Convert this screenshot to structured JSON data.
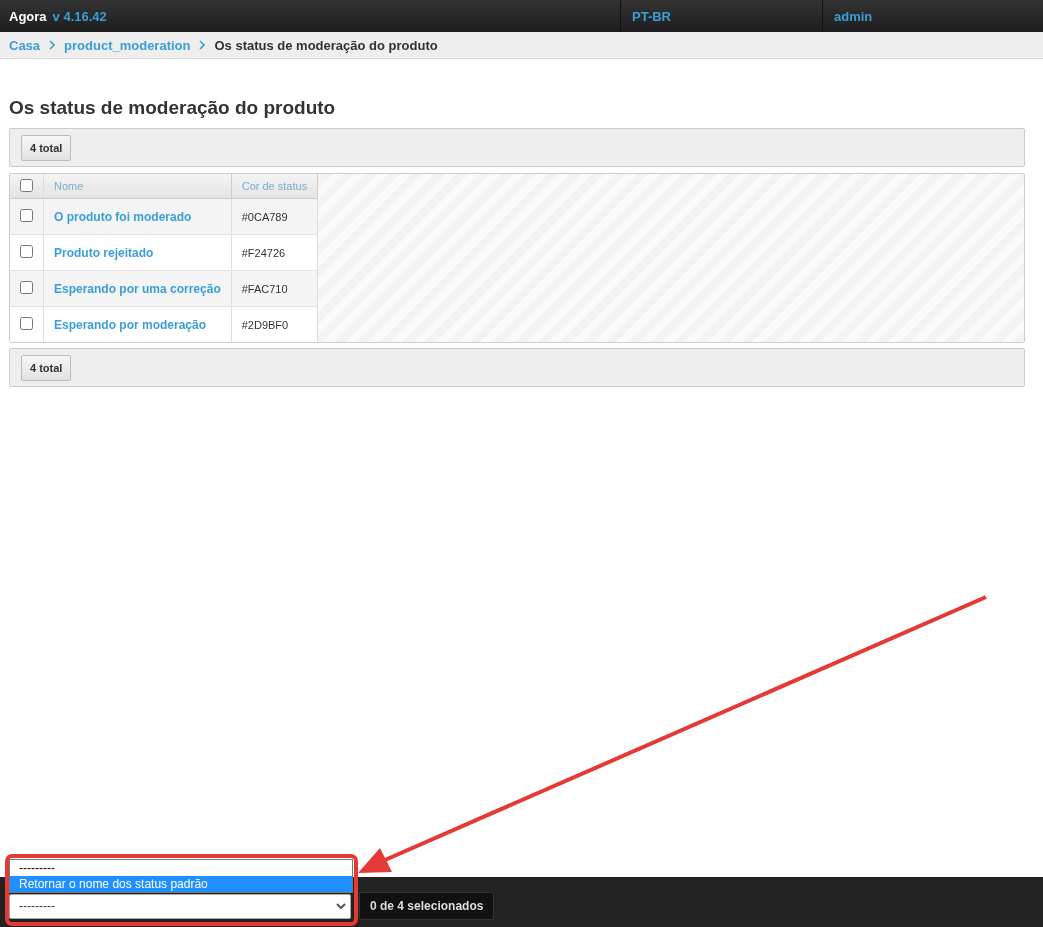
{
  "header": {
    "brand": "Agora",
    "version": "v 4.16.42",
    "menu": [
      "PT-BR",
      "admin"
    ]
  },
  "breadcrumb": {
    "links": [
      "Casa",
      "product_moderation"
    ],
    "current": "Os status de moderação do produto"
  },
  "title": "Os status de moderação do produto",
  "top_toolbar": {
    "count": "4 total"
  },
  "table": {
    "select_all": {
      "checked": false
    },
    "columns": [
      "Nome",
      "Cor de status"
    ],
    "rows": [
      {
        "checked": false,
        "name": "O produto foi moderado",
        "status_color": "#0CA789"
      },
      {
        "checked": false,
        "name": "Produto rejeitado",
        "status_color": "#F24726"
      },
      {
        "checked": false,
        "name": "Esperando por uma correção",
        "status_color": "#FAC710"
      },
      {
        "checked": false,
        "name": "Esperando por moderação",
        "status_color": "#2D9BF0"
      }
    ]
  },
  "bottom_toolbar": {
    "count": "4 total"
  },
  "action_bar": {
    "select_value": "---------",
    "options": [
      {
        "label": "---------",
        "selected": false
      },
      {
        "label": "Retornar o nome dos status padrão",
        "selected": true
      }
    ],
    "selection_count": "0 de 4 selecionados"
  }
}
